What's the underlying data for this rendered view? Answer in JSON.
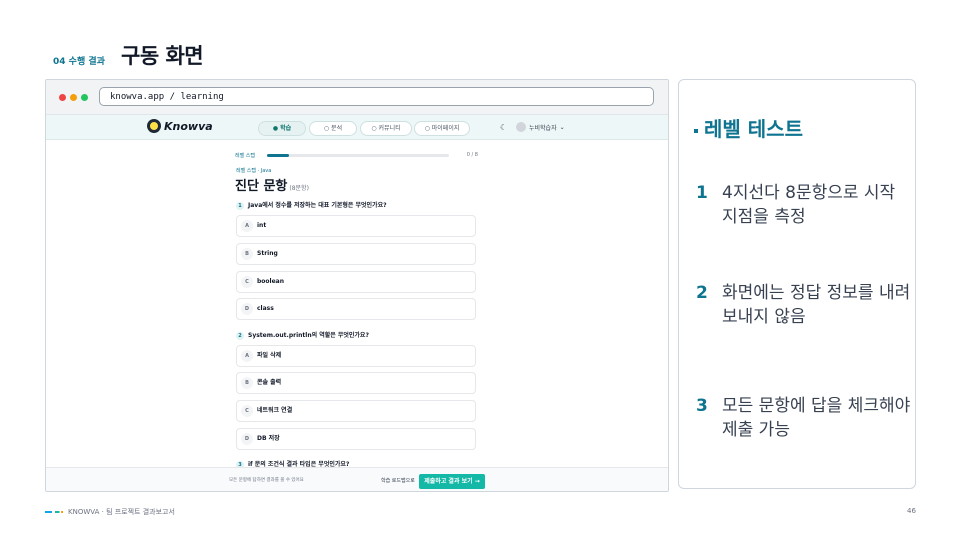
{
  "slide": {
    "tag": "04 수행 결과",
    "title": "구동 화면"
  },
  "browser": {
    "url": "knowva.app / learning"
  },
  "app": {
    "logo": "Knowva",
    "nav": [
      "학습",
      "분석",
      "커뮤니티",
      "마이페이지"
    ],
    "user": "누비학습자",
    "progress": {
      "label": "레벨 스텝",
      "count": "0 / 8",
      "fraction": 0.12
    },
    "breadcrumb": "레벨 스텝 · Java",
    "title": "진단 문항",
    "title_sub": "(8문항)",
    "questions": [
      {
        "num": "1",
        "text": "Java에서 정수를 저장하는 대표 기본형은 무엇인가요?",
        "options": [
          {
            "letter": "A",
            "text": "int"
          },
          {
            "letter": "B",
            "text": "String"
          },
          {
            "letter": "C",
            "text": "boolean"
          },
          {
            "letter": "D",
            "text": "class"
          }
        ]
      },
      {
        "num": "2",
        "text": "System.out.println의 역할은 무엇인가요?",
        "options": [
          {
            "letter": "A",
            "text": "파일 삭제"
          },
          {
            "letter": "B",
            "text": "콘솔 출력"
          },
          {
            "letter": "C",
            "text": "네트워크 연결"
          },
          {
            "letter": "D",
            "text": "DB 저장"
          }
        ]
      },
      {
        "num": "3",
        "text": "if 문의 조건식 결과 타입은 무엇인가요?"
      }
    ],
    "footer_note": "모든 문항에 답하면 결과를 볼 수 있어요",
    "footer_count": "학습 로드맵으로",
    "submit": "제출하고 결과 보기 →"
  },
  "panel": {
    "title": "레벨 테스트",
    "points": [
      {
        "n": "1",
        "text": "4지선다 8문항으로 시작 지점을 측정"
      },
      {
        "n": "2",
        "text": "화면에는 정답 정보를 내려보내지 않음"
      },
      {
        "n": "3",
        "text": "모든 문항에 답을 체크해야 제출 가능"
      }
    ]
  },
  "footer": {
    "label": "KNOWVA · 팀 프로젝트 결과보고서",
    "page": "46"
  }
}
